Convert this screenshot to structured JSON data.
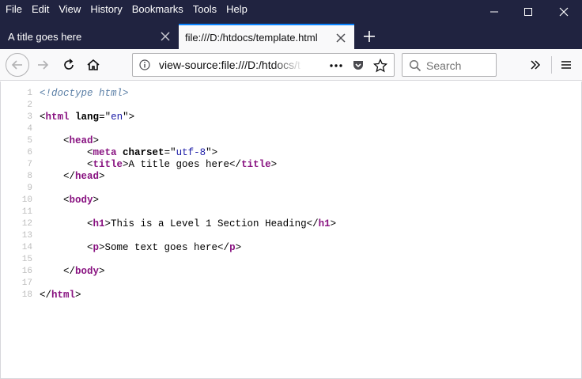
{
  "menu": [
    "File",
    "Edit",
    "View",
    "History",
    "Bookmarks",
    "Tools",
    "Help"
  ],
  "tabs": [
    {
      "title": "A title goes here",
      "active": false
    },
    {
      "title": "file:///D:/htdocs/template.html",
      "active": true
    }
  ],
  "url": "view-source:file:///D:/htdocs/t",
  "search": {
    "placeholder": "Search"
  },
  "colors": {
    "frame": "#202340",
    "accent": "#0a84ff",
    "tag": "#881280",
    "attr_value": "#1a1aa6",
    "doctype": "#5b7fa6"
  },
  "source_lines": [
    {
      "n": "1",
      "parts": [
        {
          "t": "<!doctype html>",
          "c": "doctype"
        }
      ]
    },
    {
      "n": "2",
      "parts": []
    },
    {
      "n": "3",
      "parts": [
        {
          "t": "<",
          "c": "txt"
        },
        {
          "t": "html",
          "c": "tagn"
        },
        {
          "t": " ",
          "c": "txt"
        },
        {
          "t": "lang",
          "c": "attrn"
        },
        {
          "t": "=\"",
          "c": "txt"
        },
        {
          "t": "en",
          "c": "attrv"
        },
        {
          "t": "\">",
          "c": "txt"
        }
      ]
    },
    {
      "n": "4",
      "parts": []
    },
    {
      "n": "5",
      "parts": [
        {
          "t": "    <",
          "c": "txt"
        },
        {
          "t": "head",
          "c": "tagn"
        },
        {
          "t": ">",
          "c": "txt"
        }
      ]
    },
    {
      "n": "6",
      "parts": [
        {
          "t": "        <",
          "c": "txt"
        },
        {
          "t": "meta",
          "c": "tagn"
        },
        {
          "t": " ",
          "c": "txt"
        },
        {
          "t": "charset",
          "c": "attrn"
        },
        {
          "t": "=\"",
          "c": "txt"
        },
        {
          "t": "utf-8",
          "c": "attrv"
        },
        {
          "t": "\">",
          "c": "txt"
        }
      ]
    },
    {
      "n": "7",
      "parts": [
        {
          "t": "        <",
          "c": "txt"
        },
        {
          "t": "title",
          "c": "tagn"
        },
        {
          "t": ">A title goes here</",
          "c": "txt"
        },
        {
          "t": "title",
          "c": "tagn"
        },
        {
          "t": ">",
          "c": "txt"
        }
      ]
    },
    {
      "n": "8",
      "parts": [
        {
          "t": "    </",
          "c": "txt"
        },
        {
          "t": "head",
          "c": "tagn"
        },
        {
          "t": ">",
          "c": "txt"
        }
      ]
    },
    {
      "n": "9",
      "parts": []
    },
    {
      "n": "10",
      "parts": [
        {
          "t": "    <",
          "c": "txt"
        },
        {
          "t": "body",
          "c": "tagn"
        },
        {
          "t": ">",
          "c": "txt"
        }
      ]
    },
    {
      "n": "11",
      "parts": []
    },
    {
      "n": "12",
      "parts": [
        {
          "t": "        <",
          "c": "txt"
        },
        {
          "t": "h1",
          "c": "tagn"
        },
        {
          "t": ">This is a Level 1 Section Heading</",
          "c": "txt"
        },
        {
          "t": "h1",
          "c": "tagn"
        },
        {
          "t": ">",
          "c": "txt"
        }
      ]
    },
    {
      "n": "13",
      "parts": []
    },
    {
      "n": "14",
      "parts": [
        {
          "t": "        <",
          "c": "txt"
        },
        {
          "t": "p",
          "c": "tagn"
        },
        {
          "t": ">Some text goes here</",
          "c": "txt"
        },
        {
          "t": "p",
          "c": "tagn"
        },
        {
          "t": ">",
          "c": "txt"
        }
      ]
    },
    {
      "n": "15",
      "parts": []
    },
    {
      "n": "16",
      "parts": [
        {
          "t": "    </",
          "c": "txt"
        },
        {
          "t": "body",
          "c": "tagn"
        },
        {
          "t": ">",
          "c": "txt"
        }
      ]
    },
    {
      "n": "17",
      "parts": []
    },
    {
      "n": "18",
      "parts": [
        {
          "t": "</",
          "c": "txt"
        },
        {
          "t": "html",
          "c": "tagn"
        },
        {
          "t": ">",
          "c": "txt"
        }
      ]
    }
  ]
}
